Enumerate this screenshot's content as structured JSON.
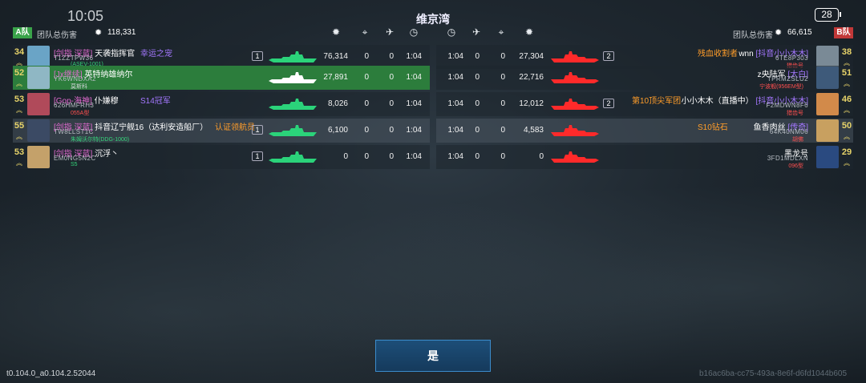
{
  "status": {
    "clock": "10:05",
    "battery": "28"
  },
  "map_name": "维京湾",
  "team_a": {
    "tag": "A队",
    "damage_label": "团队总伤害",
    "total_damage": "118,331",
    "players": [
      {
        "level": "34",
        "clan": "[剑指 深蓝]",
        "name": "天袭指挥官",
        "title": "幸运之宠",
        "title_style": "title",
        "player_id": "T1ZZTPW36",
        "ship": "(ASEV-1001)",
        "ship_style": "ship-green",
        "badge": "1",
        "damage": "76,314",
        "assists": "0",
        "kills": "0",
        "time": "1:04",
        "avatar": "#6aa4c6",
        "ship_color": "#2bd37a",
        "row_style": "dark"
      },
      {
        "level": "52",
        "clan": "[Jx继续]",
        "name": "英特纳雄纳尔",
        "title": "",
        "title_style": "title",
        "player_id": "YK6WNDXA2",
        "ship": "莫斯科",
        "ship_style": "ship-white",
        "badge": "",
        "damage": "27,891",
        "assists": "0",
        "kills": "0",
        "time": "1:04",
        "avatar": "#8fb7c4",
        "ship_color": "#ffffff",
        "row_style": "highlight"
      },
      {
        "level": "53",
        "clan": "[Gop-海神]",
        "name": "仆嫌穆",
        "title": "S14冠军",
        "title_style": "title",
        "player_id": "626HMFRH3",
        "ship": "055A型",
        "ship_style": "ship-red",
        "badge": "",
        "damage": "8,026",
        "assists": "0",
        "kills": "0",
        "time": "1:04",
        "avatar": "#b04a5a",
        "ship_color": "#2bd37a",
        "row_style": "dark"
      },
      {
        "level": "55",
        "clan": "[剑指 深蓝]",
        "name": "抖音辽宁舰16（达利安造船厂）",
        "title": "认证领航员",
        "title_style": "title-orange",
        "player_id": "TW8LLST1C",
        "ship": "朱姆沃尔特(DDG-1000)",
        "ship_style": "ship-green",
        "badge": "1",
        "damage": "6,100",
        "assists": "0",
        "kills": "0",
        "time": "1:04",
        "avatar": "#3b4a64",
        "ship_color": "#2bd37a",
        "row_style": "mid"
      },
      {
        "level": "53",
        "clan": "[剑指 深蓝]",
        "name": "沉浮丶",
        "title": "",
        "title_style": "title",
        "player_id": "EM0NG5N2C",
        "ship": "S5",
        "ship_style": "ship-green",
        "badge": "1",
        "damage": "0",
        "assists": "0",
        "kills": "0",
        "time": "1:04",
        "avatar": "#c4a16a",
        "ship_color": "#2bd37a",
        "row_style": "dark"
      }
    ]
  },
  "team_b": {
    "tag": "B队",
    "damage_label": "团队总伤害",
    "total_damage": "66,615",
    "players": [
      {
        "level": "38",
        "clan": "[抖音小小木木]",
        "name": "wnn",
        "title": "残血收割者",
        "title_style": "title-orange",
        "player_id": "6TE8P303",
        "ship": "猎齿号",
        "ship_style": "ship-red",
        "badge": "2",
        "damage": "27,304",
        "assists": "0",
        "kills": "0",
        "time": "1:04",
        "avatar": "#7a8a96",
        "ship_color": "#ff2a2a",
        "row_style": "dark"
      },
      {
        "level": "51",
        "clan": "[太白]",
        "name": "z央陆军",
        "title": "",
        "title_style": "title",
        "player_id": "TPRMZSLU2",
        "ship": "宁波舰(956EM型)",
        "ship_style": "ship-red",
        "badge": "",
        "damage": "22,716",
        "assists": "0",
        "kills": "0",
        "time": "1:04",
        "avatar": "#3e5a7a",
        "ship_color": "#ff2a2a",
        "row_style": "dark"
      },
      {
        "level": "46",
        "clan": "[抖音小小木木]",
        "name": "小小木木（直播中）",
        "title": "第10顶尖军团",
        "title_style": "title-orange",
        "player_id": "F2MDWN8F6",
        "ship": "猎齿号",
        "ship_style": "ship-red",
        "badge": "2",
        "damage": "12,012",
        "assists": "0",
        "kills": "0",
        "time": "1:04",
        "avatar": "#d28a4a",
        "ship_color": "#ff2a2a",
        "row_style": "dark"
      },
      {
        "level": "50",
        "clan": "[传奇]",
        "name": "鱼香肉丝",
        "title": "S10钻石",
        "title_style": "title-orange",
        "player_id": "64K40NM06",
        "ship": "胡佛",
        "ship_style": "ship-red",
        "badge": "",
        "damage": "4,583",
        "assists": "0",
        "kills": "0",
        "time": "1:04",
        "avatar": "#c8a060",
        "ship_color": "#ff2a2a",
        "row_style": "mid"
      },
      {
        "level": "29",
        "clan": "",
        "name": "黑龙号",
        "title": "",
        "title_style": "title",
        "player_id": "3FD1MDLXN",
        "ship": "096型",
        "ship_style": "ship-red",
        "badge": "",
        "damage": "0",
        "assists": "0",
        "kills": "0",
        "time": "1:04",
        "avatar": "#2a4a80",
        "ship_color": "#ff2a2a",
        "row_style": "dark"
      }
    ]
  },
  "confirm_label": "是",
  "version": "t0.104.0_a0.104.2.52044",
  "session_id": "b16ac6ba-cc75-493a-8e6f-d6fd1044b605"
}
